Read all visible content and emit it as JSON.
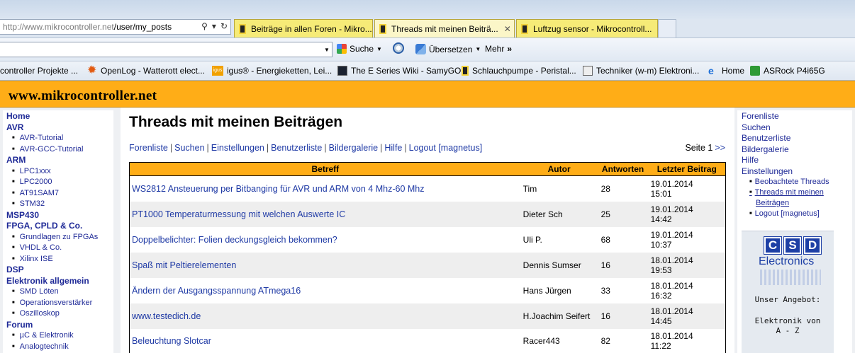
{
  "browser": {
    "address": {
      "host": "http://www.mikrocontroller.net",
      "path": "/user/my_posts"
    },
    "tabs": [
      {
        "title": "Beiträge in allen Foren - Mikro...",
        "active": false
      },
      {
        "title": "Threads mit meinen Beiträ...",
        "active": true
      },
      {
        "title": "Luftzug sensor - Mikrocontroll...",
        "active": false
      }
    ],
    "toolbar": {
      "search_label": "Suche",
      "translate_label": "Übersetzen",
      "more_label": "Mehr"
    },
    "bookmarks": [
      "controller Projekte ...",
      "OpenLog - Watterott elect...",
      "igus® - Energieketten, Lei...",
      "The E Series Wiki - SamyGO",
      "Schlauchpumpe - Peristal...",
      "Techniker (w-m) Elektroni...",
      "Home",
      "ASRock  P4i65G"
    ],
    "bookmark_icon_labels": {
      "igus": "igus"
    }
  },
  "site": {
    "title": "www.mikrocontroller.net"
  },
  "left_nav": [
    {
      "label": "Home",
      "type": "section"
    },
    {
      "label": "AVR",
      "type": "section"
    },
    {
      "label": "AVR-Tutorial",
      "type": "sub"
    },
    {
      "label": "AVR-GCC-Tutorial",
      "type": "sub"
    },
    {
      "label": "ARM",
      "type": "section"
    },
    {
      "label": "LPC1xxx",
      "type": "sub"
    },
    {
      "label": "LPC2000",
      "type": "sub"
    },
    {
      "label": "AT91SAM7",
      "type": "sub"
    },
    {
      "label": "STM32",
      "type": "sub"
    },
    {
      "label": "MSP430",
      "type": "section"
    },
    {
      "label": "FPGA, CPLD & Co.",
      "type": "section"
    },
    {
      "label": "Grundlagen zu FPGAs",
      "type": "sub"
    },
    {
      "label": "VHDL & Co.",
      "type": "sub"
    },
    {
      "label": "Xilinx ISE",
      "type": "sub"
    },
    {
      "label": "DSP",
      "type": "section"
    },
    {
      "label": "Elektronik allgemein",
      "type": "section"
    },
    {
      "label": "SMD Löten",
      "type": "sub"
    },
    {
      "label": "Operationsverstärker",
      "type": "sub"
    },
    {
      "label": "Oszilloskop",
      "type": "sub"
    },
    {
      "label": "Forum",
      "type": "section"
    },
    {
      "label": "µC & Elektronik",
      "type": "sub"
    },
    {
      "label": "Analogtechnik",
      "type": "sub"
    }
  ],
  "main": {
    "title": "Threads mit meinen Beiträgen",
    "links": [
      "Forenliste",
      "Suchen",
      "Einstellungen",
      "Benutzerliste",
      "Bildergalerie",
      "Hilfe",
      "Logout [magnetus]"
    ],
    "pager": {
      "label": "Seite 1",
      "next": ">>"
    },
    "table": {
      "headers": [
        "Betreff",
        "Autor",
        "Antworten",
        "Letzter Beitrag"
      ],
      "rows": [
        {
          "subject": "WS2812 Ansteuerung per Bitbanging für AVR und ARM von 4 Mhz-60 Mhz",
          "author": "Tim",
          "replies": "28",
          "date": "19.01.2014",
          "time": "15:01"
        },
        {
          "subject": "PT1000 Temperaturmessung mit welchen Auswerte IC",
          "author": "Dieter Sch",
          "replies": "25",
          "date": "19.01.2014",
          "time": "14:42"
        },
        {
          "subject": "Doppelbelichter: Folien deckungsgleich bekommen?",
          "author": "Uli P.",
          "replies": "68",
          "date": "19.01.2014",
          "time": "10:37"
        },
        {
          "subject": "Spaß mit Peltierelementen",
          "author": "Dennis Sumser",
          "replies": "16",
          "date": "18.01.2014",
          "time": "19:53"
        },
        {
          "subject": "Ändern der Ausgangsspannung ATmega16",
          "author": "Hans Jürgen",
          "replies": "33",
          "date": "18.01.2014",
          "time": "16:32"
        },
        {
          "subject": "www.testedich.de",
          "author": "H.Joachim Seifert",
          "replies": "16",
          "date": "18.01.2014",
          "time": "14:45"
        },
        {
          "subject": "Beleuchtung Slotcar",
          "author": "Racer443",
          "replies": "82",
          "date": "18.01.2014",
          "time": "11:22"
        }
      ]
    }
  },
  "right_nav": {
    "items": [
      "Forenliste",
      "Suchen",
      "Benutzerliste",
      "Bildergalerie",
      "Hilfe",
      "Einstellungen"
    ],
    "subitems": [
      {
        "label": "Beobachtete Threads",
        "current": false
      },
      {
        "label": "Threads mit meinen Beiträgen",
        "current": true
      },
      {
        "label": "Logout [magnetus]",
        "current": false
      }
    ],
    "ad": {
      "logo_letters": [
        "C",
        "S",
        "D"
      ],
      "logo_word": "Electronics",
      "line1": "Unser Angebot:",
      "line2": "Elektronik von",
      "line3": "A - Z"
    }
  },
  "colors": {
    "header_orange": "#ffad17",
    "link_blue": "#1f3aa5",
    "tab_yellow": "#f6eb77"
  }
}
